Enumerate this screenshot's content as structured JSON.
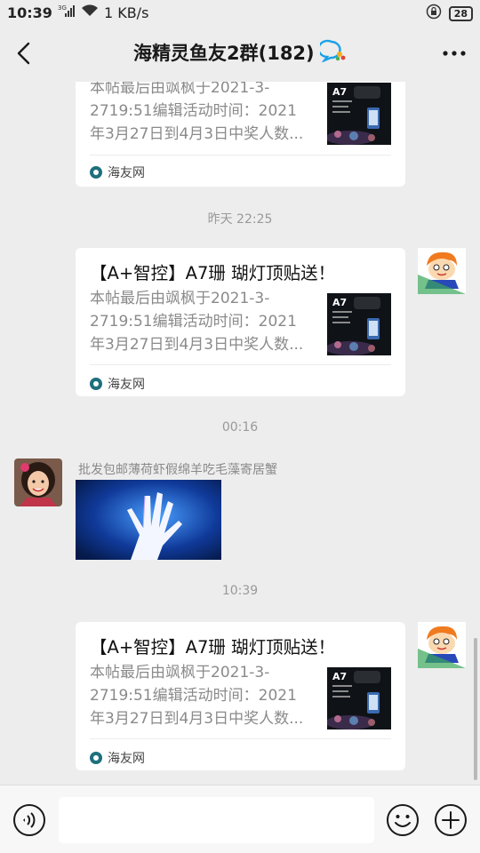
{
  "status": {
    "time": "10:39",
    "network": "3G",
    "speed": "1 KB/s",
    "battery": "28"
  },
  "header": {
    "title": "海精灵鱼友2群(182)",
    "back_icon": "back-arrow-icon",
    "more_icon": "more-dots-icon"
  },
  "messages": {
    "card1": {
      "desc": "本帖最后由飒枫于2021-3-2719:51编辑活动时间：2021年3月27日到4月3日中奖人数...",
      "thumb_text": "A7",
      "source": "海友网"
    },
    "time1": "昨天 22:25",
    "card2": {
      "title": "【A+智控】A7珊 瑚灯顶贴送！",
      "desc": "本帖最后由飒枫于2021-3-2719:51编辑活动时间：2021年3月27日到4月3日中奖人数...",
      "thumb_text": "A7",
      "source": "海友网"
    },
    "time2": "00:16",
    "sender_name": "批发包邮薄荷虾假绵羊吃毛藻寄居蟹",
    "time3": "10:39",
    "card3": {
      "title": "【A+智控】A7珊 瑚灯顶贴送！",
      "desc": "本帖最后由飒枫于2021-3-2719:51编辑活动时间：2021年3月27日到4月3日中奖人数...",
      "thumb_text": "A7",
      "source": "海友网"
    }
  },
  "input": {
    "placeholder": ""
  },
  "colors": {
    "background": "#ededed",
    "card": "#ffffff",
    "source_icon": "#1f6f7d"
  }
}
